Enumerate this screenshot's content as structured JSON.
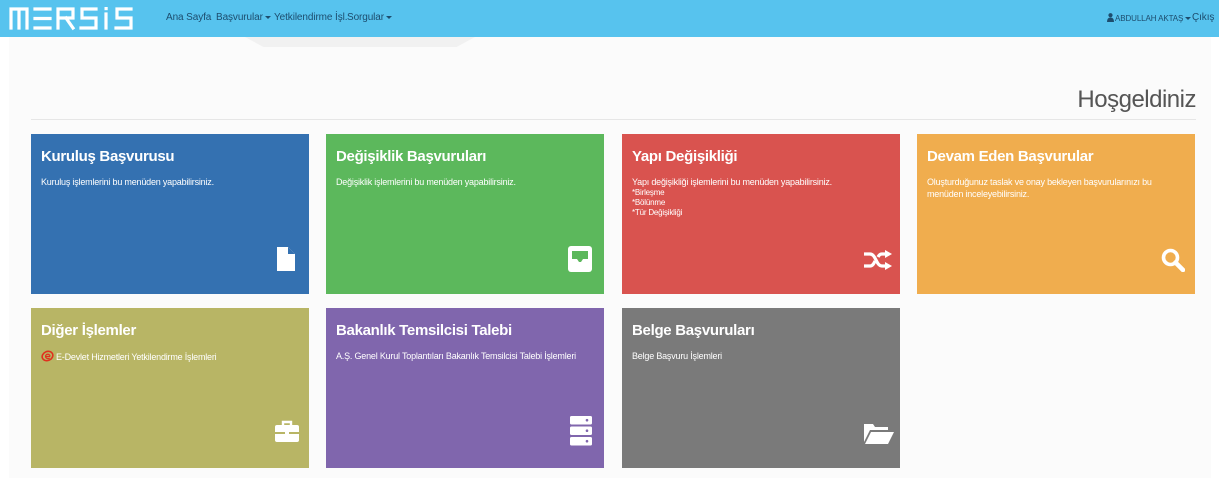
{
  "colors": {
    "navbar": "#57c3ee",
    "kurulus": "#3471b1",
    "degisiklik": "#5cb85c",
    "yapi": "#d9534f",
    "devam": "#f0ad4e",
    "diger": "#b8b565",
    "bakanlik": "#8066ad",
    "belge": "#7a7a7a"
  },
  "navbar": {
    "logo_text": "MERSİS",
    "items": [
      {
        "label": "Ana Sayfa",
        "dropdown": false
      },
      {
        "label": "Başvurular",
        "dropdown": true
      },
      {
        "label": "Yetkilendirme İşl.",
        "dropdown": false
      },
      {
        "label": "Sorgular",
        "dropdown": true
      }
    ],
    "user": {
      "name": "ABDULLAH AKTAŞ",
      "icon": "user-icon",
      "dropdown": true
    },
    "logout_label": "Çıkış"
  },
  "page": {
    "title": "Hoşgeldiniz"
  },
  "tiles": [
    {
      "title": "Kuruluş Başvurusu",
      "description": "Kuruluş işlemlerini bu menüden yapabilirsiniz.",
      "icon": "file-icon",
      "color": "#3471b1"
    },
    {
      "title": "Değişiklik Başvuruları",
      "description": "Değişiklik işlemlerini bu menüden yapabilirsiniz.",
      "icon": "inbox-icon",
      "color": "#5cb85c"
    },
    {
      "title": "Yapı Değişikliği",
      "description": "Yapı değişikliği işlemlerini bu menüden yapabilirsiniz.",
      "items": [
        "*Birleşme",
        "*Bölünme",
        "*Tür Değişikliği"
      ],
      "icon": "shuffle-icon",
      "color": "#d9534f"
    },
    {
      "title": "Devam Eden Başvurular",
      "description": "Oluşturduğunuz taslak ve onay bekleyen başvurularınızı bu menüden inceleyebilirsiniz.",
      "icon": "search-icon",
      "color": "#f0ad4e"
    },
    {
      "title": "Diğer İşlemler",
      "link_text": "E-Devlet Hizmetleri Yetkilendirme İşlemleri",
      "icon": "briefcase-icon",
      "color": "#b8b565"
    },
    {
      "title": "Bakanlık Temsilcisi Talebi",
      "description": "A.Ş. Genel Kurul Toplantıları Bakanlık Temsilcisi Talebi İşlemleri",
      "icon": "server-icon",
      "color": "#8066ad"
    },
    {
      "title": "Belge Başvuruları",
      "description": "Belge Başvuru İşlemleri",
      "icon": "folder-open-icon",
      "color": "#7a7a7a"
    }
  ]
}
